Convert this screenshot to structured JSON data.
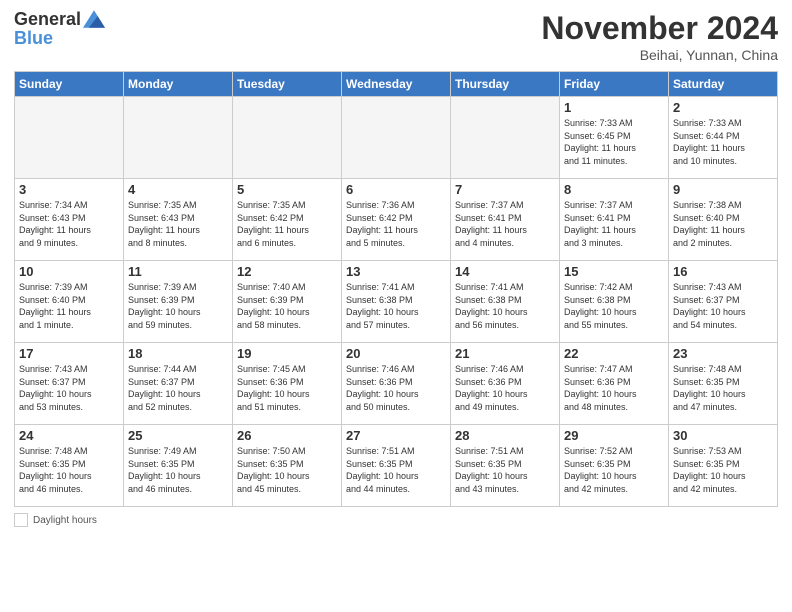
{
  "logo": {
    "general": "General",
    "blue": "Blue"
  },
  "header": {
    "month": "November 2024",
    "location": "Beihai, Yunnan, China"
  },
  "weekdays": [
    "Sunday",
    "Monday",
    "Tuesday",
    "Wednesday",
    "Thursday",
    "Friday",
    "Saturday"
  ],
  "weeks": [
    [
      {
        "day": "",
        "info": ""
      },
      {
        "day": "",
        "info": ""
      },
      {
        "day": "",
        "info": ""
      },
      {
        "day": "",
        "info": ""
      },
      {
        "day": "",
        "info": ""
      },
      {
        "day": "1",
        "info": "Sunrise: 7:33 AM\nSunset: 6:45 PM\nDaylight: 11 hours\nand 11 minutes."
      },
      {
        "day": "2",
        "info": "Sunrise: 7:33 AM\nSunset: 6:44 PM\nDaylight: 11 hours\nand 10 minutes."
      }
    ],
    [
      {
        "day": "3",
        "info": "Sunrise: 7:34 AM\nSunset: 6:43 PM\nDaylight: 11 hours\nand 9 minutes."
      },
      {
        "day": "4",
        "info": "Sunrise: 7:35 AM\nSunset: 6:43 PM\nDaylight: 11 hours\nand 8 minutes."
      },
      {
        "day": "5",
        "info": "Sunrise: 7:35 AM\nSunset: 6:42 PM\nDaylight: 11 hours\nand 6 minutes."
      },
      {
        "day": "6",
        "info": "Sunrise: 7:36 AM\nSunset: 6:42 PM\nDaylight: 11 hours\nand 5 minutes."
      },
      {
        "day": "7",
        "info": "Sunrise: 7:37 AM\nSunset: 6:41 PM\nDaylight: 11 hours\nand 4 minutes."
      },
      {
        "day": "8",
        "info": "Sunrise: 7:37 AM\nSunset: 6:41 PM\nDaylight: 11 hours\nand 3 minutes."
      },
      {
        "day": "9",
        "info": "Sunrise: 7:38 AM\nSunset: 6:40 PM\nDaylight: 11 hours\nand 2 minutes."
      }
    ],
    [
      {
        "day": "10",
        "info": "Sunrise: 7:39 AM\nSunset: 6:40 PM\nDaylight: 11 hours\nand 1 minute."
      },
      {
        "day": "11",
        "info": "Sunrise: 7:39 AM\nSunset: 6:39 PM\nDaylight: 10 hours\nand 59 minutes."
      },
      {
        "day": "12",
        "info": "Sunrise: 7:40 AM\nSunset: 6:39 PM\nDaylight: 10 hours\nand 58 minutes."
      },
      {
        "day": "13",
        "info": "Sunrise: 7:41 AM\nSunset: 6:38 PM\nDaylight: 10 hours\nand 57 minutes."
      },
      {
        "day": "14",
        "info": "Sunrise: 7:41 AM\nSunset: 6:38 PM\nDaylight: 10 hours\nand 56 minutes."
      },
      {
        "day": "15",
        "info": "Sunrise: 7:42 AM\nSunset: 6:38 PM\nDaylight: 10 hours\nand 55 minutes."
      },
      {
        "day": "16",
        "info": "Sunrise: 7:43 AM\nSunset: 6:37 PM\nDaylight: 10 hours\nand 54 minutes."
      }
    ],
    [
      {
        "day": "17",
        "info": "Sunrise: 7:43 AM\nSunset: 6:37 PM\nDaylight: 10 hours\nand 53 minutes."
      },
      {
        "day": "18",
        "info": "Sunrise: 7:44 AM\nSunset: 6:37 PM\nDaylight: 10 hours\nand 52 minutes."
      },
      {
        "day": "19",
        "info": "Sunrise: 7:45 AM\nSunset: 6:36 PM\nDaylight: 10 hours\nand 51 minutes."
      },
      {
        "day": "20",
        "info": "Sunrise: 7:46 AM\nSunset: 6:36 PM\nDaylight: 10 hours\nand 50 minutes."
      },
      {
        "day": "21",
        "info": "Sunrise: 7:46 AM\nSunset: 6:36 PM\nDaylight: 10 hours\nand 49 minutes."
      },
      {
        "day": "22",
        "info": "Sunrise: 7:47 AM\nSunset: 6:36 PM\nDaylight: 10 hours\nand 48 minutes."
      },
      {
        "day": "23",
        "info": "Sunrise: 7:48 AM\nSunset: 6:35 PM\nDaylight: 10 hours\nand 47 minutes."
      }
    ],
    [
      {
        "day": "24",
        "info": "Sunrise: 7:48 AM\nSunset: 6:35 PM\nDaylight: 10 hours\nand 46 minutes."
      },
      {
        "day": "25",
        "info": "Sunrise: 7:49 AM\nSunset: 6:35 PM\nDaylight: 10 hours\nand 46 minutes."
      },
      {
        "day": "26",
        "info": "Sunrise: 7:50 AM\nSunset: 6:35 PM\nDaylight: 10 hours\nand 45 minutes."
      },
      {
        "day": "27",
        "info": "Sunrise: 7:51 AM\nSunset: 6:35 PM\nDaylight: 10 hours\nand 44 minutes."
      },
      {
        "day": "28",
        "info": "Sunrise: 7:51 AM\nSunset: 6:35 PM\nDaylight: 10 hours\nand 43 minutes."
      },
      {
        "day": "29",
        "info": "Sunrise: 7:52 AM\nSunset: 6:35 PM\nDaylight: 10 hours\nand 42 minutes."
      },
      {
        "day": "30",
        "info": "Sunrise: 7:53 AM\nSunset: 6:35 PM\nDaylight: 10 hours\nand 42 minutes."
      }
    ]
  ],
  "legend": {
    "label": "Daylight hours"
  }
}
